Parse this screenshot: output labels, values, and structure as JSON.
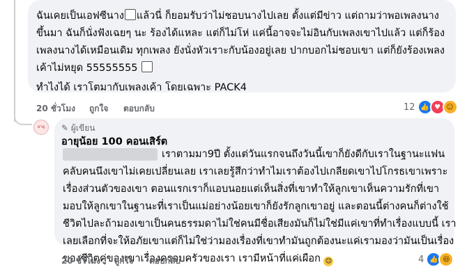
{
  "comment1": {
    "lines": [
      "ฉันเคยเป็นเอฟซีนาง",
      "แล้วนี่ ก็ยอมรับว่าไม่ชอบนางไปเลย ตั้งแต่มีข่าว แต่ถามว่าพอเพลงนาง",
      "ขึ้นมา ฉันก็นั่งฟังเฉยๆ นะ ร้องได้แหละ แต่ก็ไม่โห่ แค่นี้อาจจะไม่อินกับเพลงเขาไปแล้ว แต่ก็ร้อง",
      "เพลงนางได้เหมือนเดิม ทุกเพลง ยังนั่งหัวเราะกับน้องอยู่เลย ปากบอกไม่ชอบเขา แต่ก็ยังร้องเพลง",
      "เค้าไม่หยุด 55555555",
      "ทำไงได้ เราโตมากับเพลงเค้า โดยเฉพาะ PACK4"
    ],
    "time": "20 ชั่วโมง",
    "like": "ถูกใจ",
    "reply": "ตอบกลับ",
    "reaction_count": "12",
    "reactions": [
      "like-icon",
      "love-icon",
      "care-icon"
    ]
  },
  "comment2": {
    "badge": "ผู้เขียน",
    "author": "อายุน้อย 100 คอนเสิร์ต",
    "avatar_text": "อายุน้อย",
    "lines": [
      "เราตามมา9ปี ตั้งแต่วันแรกจนถึงวันนี้เขาก็ยังดีกับเราในฐานะแฟน",
      "คลับคนนึงเขาไม่เคยเปลี่ยนเลย เราเลยรู้สึกว่าทำไมเราต้องไปเกลียดเขาไปโกรธเขาเพราะ",
      "เรื่องส่วนตัวของเขา ตอนแรกเราก็แอบนอยแต่เห็นสิ่งที่เขาทำให้ลูกเขาเห็นความรักที่เขา",
      "มอบให้ลูกเขาในฐานะที่เราเป็นแม่อย่างน้อยเขาก็ยังรักลูกเขาอยู่ และตอนนี้ต่างคนก็ต่างใช้",
      "ชีวิตไปละถ้ามองเขาเป็นคนธรรมดาไม่ใช่คนมีชื่อเสียงมันก็ไม่ใช่มีแค่เขาที่ทำเรื่องแบบนี้ เรา",
      "เลยเลือกที่จะให้อภัยเขาแต่ก็ไม่ใช่ว่ามองเรื่องที่เขาทำมันถูกต้องนะแค่เรามองว่ามันเป็นเรื่อง",
      "ของชีวิตคู่ของเขาเรื่องครอบครัวของเรา เรามีหน้าที่แค่เผือก"
    ],
    "time": "20 ชั่วโมง",
    "like": "ถูกใจ",
    "reply": "ตอบกลับ",
    "reaction_count": "4",
    "reactions": [
      "like-icon",
      "haha-icon"
    ]
  }
}
